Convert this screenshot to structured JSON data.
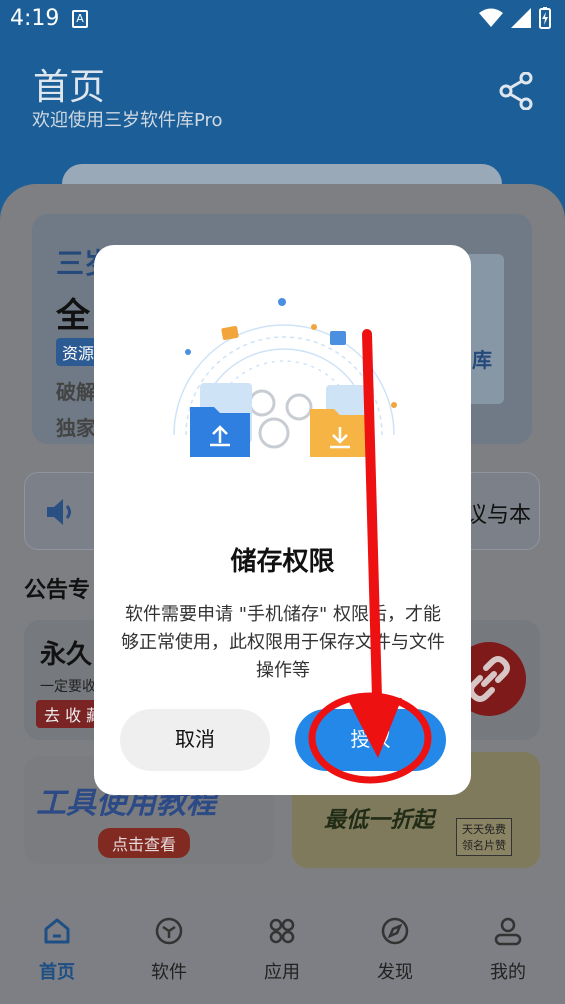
{
  "status_bar": {
    "time": "4:19",
    "notif_glyph": "A"
  },
  "header": {
    "title": "首页",
    "subtitle": "欢迎使用三岁软件库Pro"
  },
  "banner": {
    "line1": "三岁",
    "line2": "全",
    "tag": "资源",
    "line4": "破解",
    "line5": "独家",
    "right_text": "库"
  },
  "notice": {
    "text": "议与本"
  },
  "section": {
    "title": "公告专"
  },
  "cards": {
    "card1": {
      "title": "永久",
      "subtitle": "一定要收",
      "badge": "去 收 藏"
    },
    "card3": {
      "title": "工具使用教程",
      "button": "点击查看"
    },
    "card4": {
      "title": "最低一折起",
      "badge": "天天免费 领名片赞"
    }
  },
  "dialog": {
    "title": "储存权限",
    "message": "软件需要申请 \"手机储存\" 权限后，才能够正常使用，此权限用于保存文件与文件操作等",
    "cancel_label": "取消",
    "ok_label": "授权"
  },
  "tabbar": {
    "items": [
      {
        "label": "首页",
        "icon": "home-icon",
        "active": true
      },
      {
        "label": "软件",
        "icon": "cube-icon",
        "active": false
      },
      {
        "label": "应用",
        "icon": "apps-icon",
        "active": false
      },
      {
        "label": "发现",
        "icon": "compass-icon",
        "active": false
      },
      {
        "label": "我的",
        "icon": "user-icon",
        "active": false
      }
    ]
  },
  "colors": {
    "accent": "#2388e8",
    "header_bg": "#1c5f98",
    "annotation_red": "#e11"
  }
}
